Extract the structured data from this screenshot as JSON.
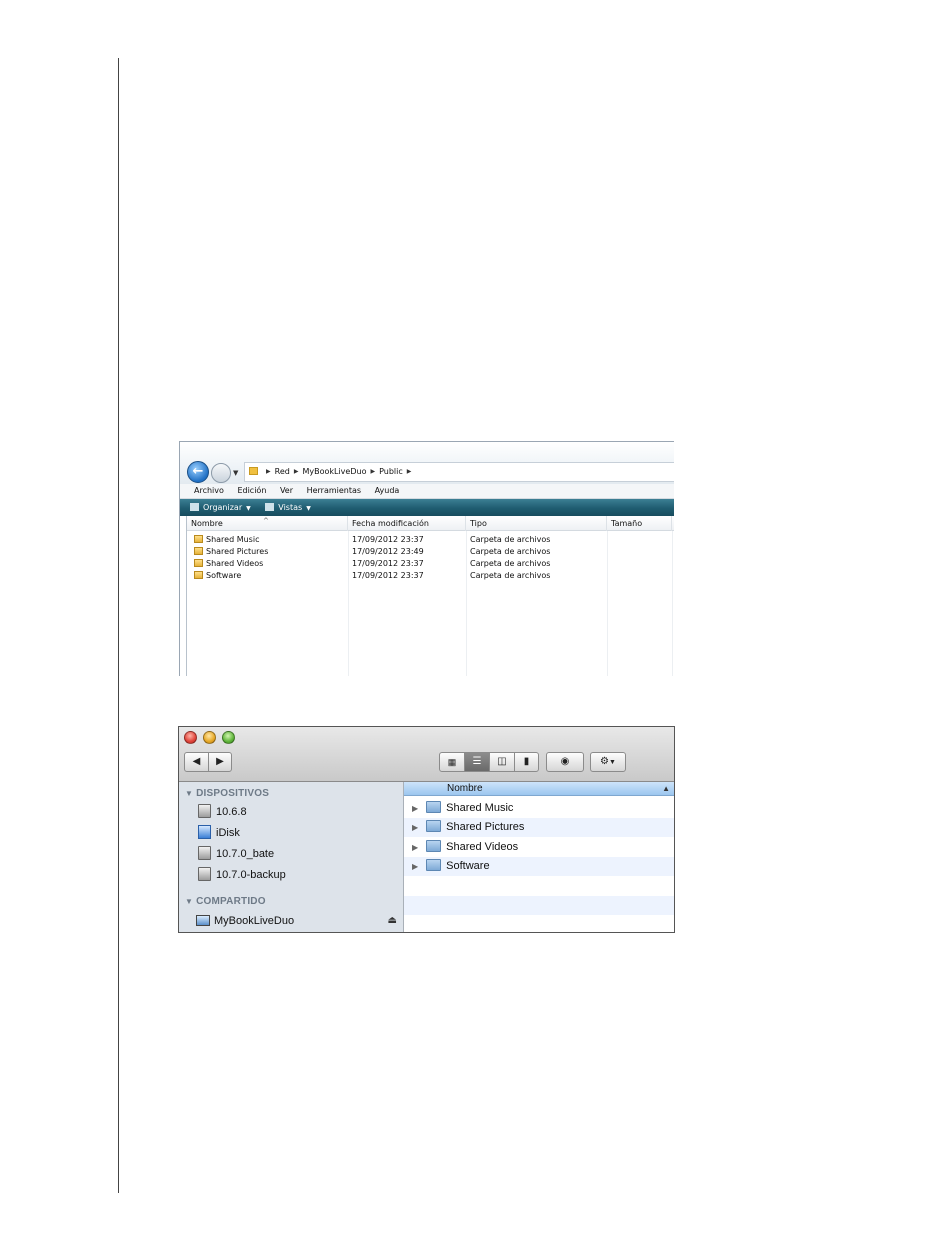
{
  "windows_explorer": {
    "breadcrumb": [
      "Red",
      "MyBookLiveDuo",
      "Public"
    ],
    "menu": [
      "Archivo",
      "Edición",
      "Ver",
      "Herramientas",
      "Ayuda"
    ],
    "toolbar": {
      "organize_label": "Organizar",
      "views_label": "Vistas"
    },
    "columns": [
      "Nombre",
      "Fecha modificación",
      "Tipo",
      "Tamaño"
    ],
    "rows": [
      {
        "name": "Shared Music",
        "date": "17/09/2012 23:37",
        "type": "Carpeta de archivos"
      },
      {
        "name": "Shared Pictures",
        "date": "17/09/2012 23:49",
        "type": "Carpeta de archivos"
      },
      {
        "name": "Shared Videos",
        "date": "17/09/2012 23:37",
        "type": "Carpeta de archivos"
      },
      {
        "name": "Software",
        "date": "17/09/2012 23:37",
        "type": "Carpeta de archivos"
      }
    ]
  },
  "mac_finder": {
    "sidebar": {
      "devices_header": "DISPOSITIVOS",
      "devices": [
        "10.6.8",
        "iDisk",
        "10.7.0_bate",
        "10.7.0-backup"
      ],
      "shared_header": "COMPARTIDO",
      "shared": [
        "MyBookLiveDuo"
      ]
    },
    "list_header": "Nombre",
    "folders": [
      "Shared Music",
      "Shared Pictures",
      "Shared Videos",
      "Software"
    ]
  }
}
